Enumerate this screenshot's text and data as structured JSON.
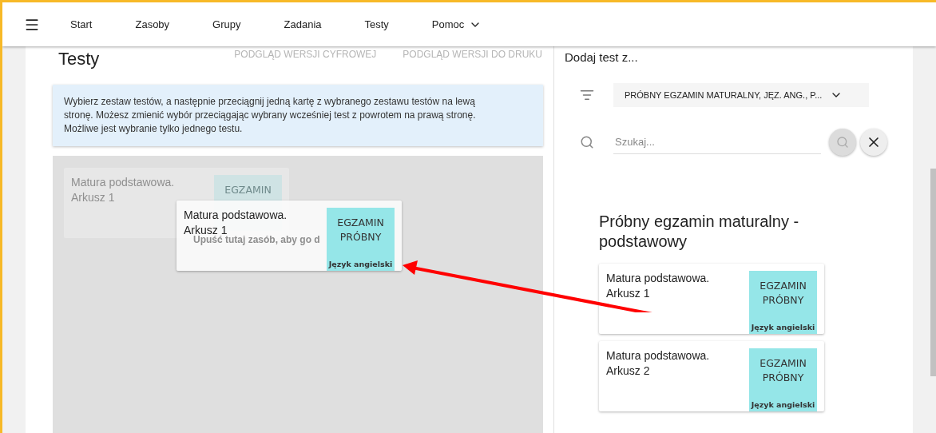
{
  "nav": {
    "items": [
      {
        "label": "Start",
        "kind": "link"
      },
      {
        "label": "Zasoby",
        "kind": "link"
      },
      {
        "label": "Grupy",
        "kind": "link"
      },
      {
        "label": "Zadania",
        "kind": "link"
      },
      {
        "label": "Testy",
        "kind": "link"
      },
      {
        "label": "Pomoc",
        "kind": "dropdown"
      }
    ]
  },
  "left": {
    "title": "Testy",
    "links": [
      "PODGLĄD WERSJI CYFROWEJ",
      "PODGLĄD WERSJI DO DRUKU"
    ],
    "info": "Wybierz zestaw testów, a następnie przeciągnij jedną kartę z wybranego zestawu testów na lewą stronę. Możesz zmienić wybór przeciągając wybrany wcześniej test z powrotem na prawą stronę. Możliwe jest wybranie tylko jednego testu.",
    "dropzone": {
      "hint": "Upuść tutaj zasób, aby go d",
      "ghost_card": {
        "title": "Matura podstawowa. Arkusz 1",
        "badge": "EGZAMIN"
      },
      "dragged_card": {
        "title": "Matura podstawowa. Arkusz 1",
        "badge": "EGZAMIN PRÓBNY",
        "subject": "Język angielski"
      }
    }
  },
  "right": {
    "heading": "Dodaj test z...",
    "filter": "PRÓBNY EGZAMIN MATURALNY, JĘZ. ANG., P...",
    "search": {
      "placeholder": "Szukaj..."
    },
    "section_title": "Próbny egzamin maturalny - podstawowy",
    "cards": [
      {
        "title": "Matura podstawowa. Arkusz 1",
        "badge": "EGZAMIN PRÓBNY",
        "subject": "Język angielski"
      },
      {
        "title": "Matura podstawowa. Arkusz 2",
        "badge": "EGZAMIN PRÓBNY",
        "subject": "Język angielski"
      }
    ]
  }
}
